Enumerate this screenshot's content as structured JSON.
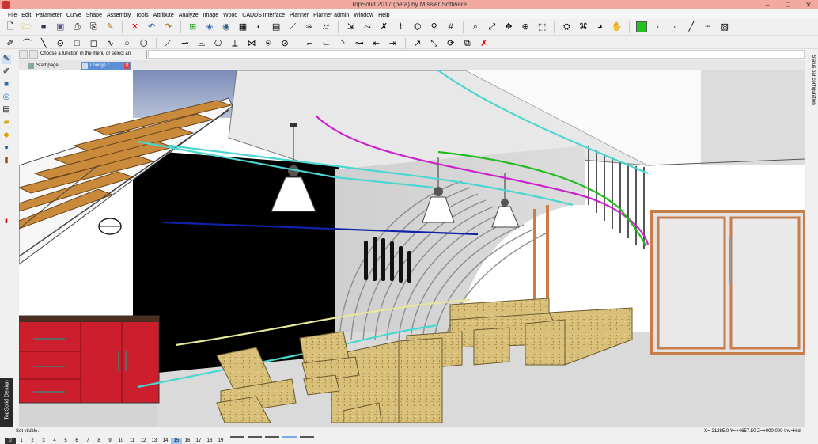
{
  "window": {
    "title": "TopSolid 2017 (beta) by Missler Software"
  },
  "menu": [
    "File",
    "Edit",
    "Parameter",
    "Curve",
    "Shape",
    "Assembly",
    "Tools",
    "Attribute",
    "Analyze",
    "Image",
    "Wood",
    "CADDS Interface",
    "Planner",
    "Planner admin",
    "Window",
    "Help"
  ],
  "prompt": {
    "text": "Choose a function in the menu or select an element",
    "value": ""
  },
  "tabs": [
    {
      "label": "Start page",
      "active": false
    },
    {
      "label": "Lounge *",
      "active": true
    }
  ],
  "brand": {
    "text": "TopSolid Design"
  },
  "right_panel": {
    "label": "Status bar configuration"
  },
  "status": {
    "text": "Set visible.",
    "coords": "X=-21285.0  Y=+4657.50  Z=+000.000  Inv=Hid",
    "layers": [
      "0",
      "1",
      "2",
      "3",
      "4",
      "5",
      "6",
      "7",
      "8",
      "9",
      "10",
      "11",
      "12",
      "13",
      "14",
      "15",
      "16",
      "17",
      "18",
      "19"
    ],
    "active_layer": "15"
  },
  "colors": {
    "title_bar": "#f1a9a0",
    "active_tab": "#5b8fd6",
    "cabinet_red": "#cc1e2d",
    "osb_wood": "#d8c07a",
    "curve_cyan": "#4ad6d1",
    "curve_magenta": "#cc22cc",
    "curve_green": "#22bb22",
    "curve_blue": "#1122aa",
    "curve_yellow": "#e8e89a"
  },
  "toolbar_icons": {
    "row1": [
      "new-icon",
      "open-icon",
      "save-icon",
      "save-all-icon",
      "print-icon",
      "print-preview-icon",
      "brush-icon",
      "delete-icon",
      "undo-icon",
      "redo-icon",
      "tree-icon",
      "layers-icon",
      "render-icon",
      "image-icon",
      "camera-icon",
      "zoom-window-icon",
      "zoom-all-icon",
      "rotate-icon",
      "color-icon",
      "line-style-icon",
      "hatch-icon"
    ],
    "row2": [
      "sketch-icon",
      "polyline-icon",
      "circle-icon",
      "rectangle-icon",
      "polygon-icon",
      "spline-icon",
      "trim-icon",
      "extend-icon",
      "fillet-icon",
      "chamfer-icon",
      "offset-icon",
      "mirror-icon",
      "move-icon",
      "delete-element-icon"
    ]
  }
}
